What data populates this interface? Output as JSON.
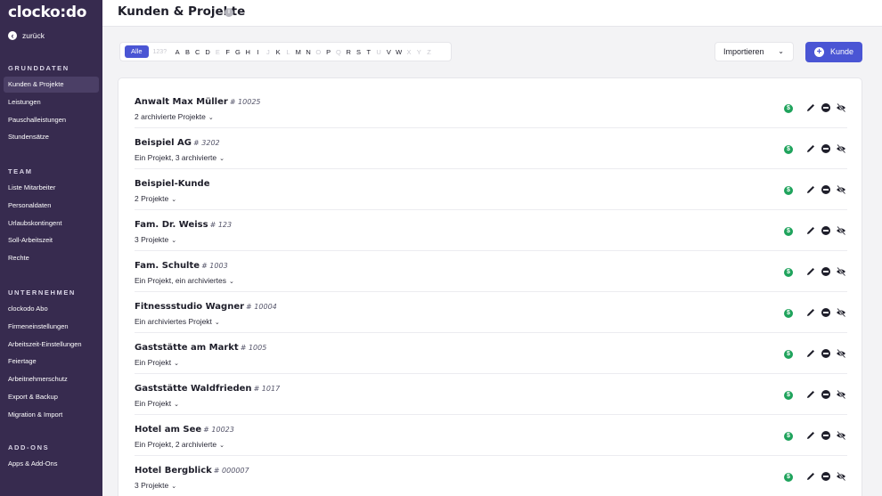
{
  "app": {
    "logo": "clocko:do",
    "back_label": "zurück"
  },
  "sidebar": {
    "sections": [
      {
        "title": "GRUNDDATEN",
        "items": [
          {
            "label": "Kunden & Projekte",
            "active": true
          },
          {
            "label": "Leistungen"
          },
          {
            "label": "Pauschalleistungen"
          },
          {
            "label": "Stundensätze"
          }
        ]
      },
      {
        "title": "TEAM",
        "items": [
          {
            "label": "Liste Mitarbeiter"
          },
          {
            "label": "Personaldaten"
          },
          {
            "label": "Urlaubskontingent"
          },
          {
            "label": "Soll-Arbeitszeit"
          },
          {
            "label": "Rechte"
          }
        ]
      },
      {
        "title": "UNTERNEHMEN",
        "items": [
          {
            "label": "clockodo Abo"
          },
          {
            "label": "Firmeneinstellungen"
          },
          {
            "label": "Arbeitszeit-Einstellungen"
          },
          {
            "label": "Feiertage"
          },
          {
            "label": "Arbeitnehmerschutz"
          },
          {
            "label": "Export & Backup"
          },
          {
            "label": "Migration & Import"
          }
        ]
      },
      {
        "title": "ADD-ONS",
        "items": [
          {
            "label": "Apps & Add-Ons"
          }
        ]
      }
    ]
  },
  "header": {
    "title": "Kunden & Projekte"
  },
  "filter": {
    "all_label": "Alle",
    "numbers_label": "123?",
    "letters": [
      {
        "l": "A",
        "dim": false
      },
      {
        "l": "B",
        "dim": false
      },
      {
        "l": "C",
        "dim": false
      },
      {
        "l": "D",
        "dim": false
      },
      {
        "l": "E",
        "dim": true
      },
      {
        "l": "F",
        "dim": false
      },
      {
        "l": "G",
        "dim": false
      },
      {
        "l": "H",
        "dim": false
      },
      {
        "l": "I",
        "dim": false
      },
      {
        "l": "J",
        "dim": true
      },
      {
        "l": "K",
        "dim": false
      },
      {
        "l": "L",
        "dim": true
      },
      {
        "l": "M",
        "dim": false
      },
      {
        "l": "N",
        "dim": false
      },
      {
        "l": "O",
        "dim": true
      },
      {
        "l": "P",
        "dim": false
      },
      {
        "l": "Q",
        "dim": true
      },
      {
        "l": "R",
        "dim": false
      },
      {
        "l": "S",
        "dim": false
      },
      {
        "l": "T",
        "dim": false
      },
      {
        "l": "U",
        "dim": true
      },
      {
        "l": "V",
        "dim": false
      },
      {
        "l": "W",
        "dim": false
      },
      {
        "l": "X",
        "dim": true
      },
      {
        "l": "Y",
        "dim": true
      },
      {
        "l": "Z",
        "dim": true
      }
    ]
  },
  "actions": {
    "import_label": "Importieren",
    "add_label": "Kunde"
  },
  "customers": [
    {
      "name": "Anwalt Max Müller",
      "number": "# 10025",
      "projects": "2 archivierte Projekte"
    },
    {
      "name": "Beispiel AG",
      "number": "# 3202",
      "projects": "Ein Projekt, 3 archivierte"
    },
    {
      "name": "Beispiel-Kunde",
      "number": "",
      "projects": "2 Projekte"
    },
    {
      "name": "Fam. Dr. Weiss",
      "number": "# 123",
      "projects": "3 Projekte"
    },
    {
      "name": "Fam. Schulte",
      "number": "# 1003",
      "projects": "Ein Projekt, ein archiviertes"
    },
    {
      "name": "Fitnessstudio Wagner",
      "number": "# 10004",
      "projects": "Ein archiviertes Projekt"
    },
    {
      "name": "Gaststätte am Markt",
      "number": "# 1005",
      "projects": "Ein Projekt"
    },
    {
      "name": "Gaststätte Waldfrieden",
      "number": "# 1017",
      "projects": "Ein Projekt"
    },
    {
      "name": "Hotel am See",
      "number": "# 10023",
      "projects": "Ein Projekt, 2 archivierte"
    },
    {
      "name": "Hotel Bergblick",
      "number": "# 000007",
      "projects": "3 Projekte"
    }
  ],
  "icons": {
    "status": "dollar-circle-icon",
    "edit": "pencil-icon",
    "deactivate": "no-entry-icon",
    "hide": "eye-slash-icon",
    "status_color": "#1fa35c",
    "accent": "#4a55d4",
    "sidebar_bg": "#372b4f"
  }
}
